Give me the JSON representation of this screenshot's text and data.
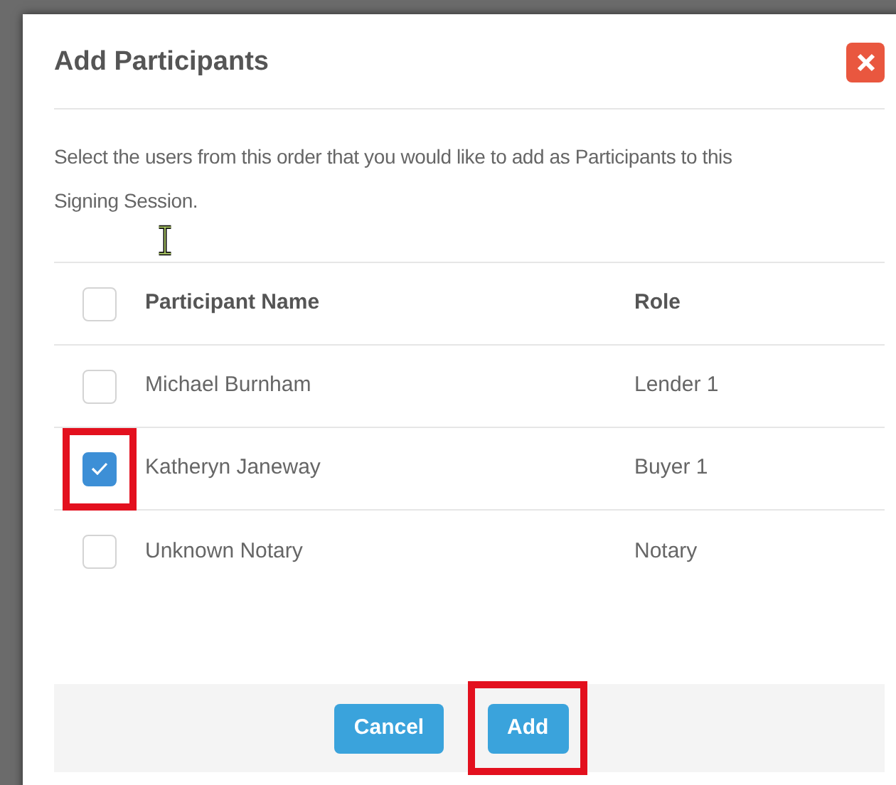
{
  "dialog": {
    "title": "Add Participants",
    "description": "Select the users from this order that you would like to add as Participants to this Signing Session."
  },
  "table": {
    "header": {
      "checked": false
    },
    "columns": [
      "Participant Name",
      "Role"
    ],
    "rows": [
      {
        "name": "Michael Burnham",
        "role": "Lender 1",
        "checked": false,
        "highlighted": false
      },
      {
        "name": "Katheryn Janeway",
        "role": "Buyer 1",
        "checked": true,
        "highlighted": true
      },
      {
        "name": "Unknown Notary",
        "role": "Notary",
        "checked": false,
        "highlighted": false
      }
    ]
  },
  "buttons": [
    {
      "label": "Cancel",
      "highlighted": false
    },
    {
      "label": "Add",
      "highlighted": true
    }
  ]
}
